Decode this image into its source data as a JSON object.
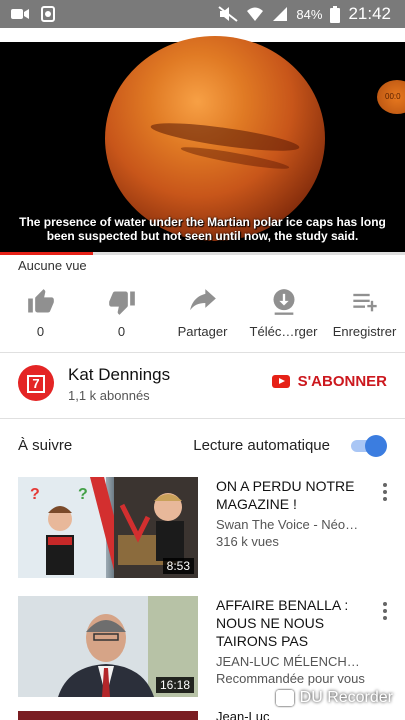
{
  "status_bar": {
    "battery": "84%",
    "time": "21:42",
    "left_icons": [
      "video-camera-icon",
      "recycle-notification-icon"
    ],
    "right_icons": [
      "mute-icon",
      "wifi-icon",
      "signal-icon",
      "battery-icon"
    ]
  },
  "player": {
    "subtitle": "The presence of water under the Martian polar ice caps has long been suspected but not seen until now, the study said.",
    "progress_fraction": 0.23,
    "overlay_badge": "00:0"
  },
  "video_info": {
    "views": "Aucune vue"
  },
  "actions": [
    {
      "icon": "thumbs-up-icon",
      "label": "0"
    },
    {
      "icon": "thumbs-down-icon",
      "label": "0"
    },
    {
      "icon": "share-icon",
      "label": "Partager"
    },
    {
      "icon": "download-icon",
      "label": "Téléc…rger"
    },
    {
      "icon": "add-to-playlist-icon",
      "label": "Enregistrer"
    }
  ],
  "channel": {
    "avatar_text": "7",
    "name": "Kat Dennings",
    "subscribers": "1,1 k abonnés",
    "subscribe_label": "S'ABONNER"
  },
  "up_next": {
    "label": "À suivre",
    "autoplay_label": "Lecture automatique",
    "autoplay_on": true
  },
  "videos": [
    {
      "title": "ON A PERDU NOTRE MAGAZINE !",
      "channel": "Swan The Voice - Néo…",
      "meta": "316 k vues",
      "duration": "8:53"
    },
    {
      "title": "AFFAIRE BENALLA : NOUS NE NOUS TAIRONS PAS",
      "channel": "JEAN-LUC MÉLENCH…",
      "meta": "Recommandée pour vous",
      "duration": "16:18"
    },
    {
      "title": "Jean-Luc"
    }
  ],
  "watermark": "DU Recorder",
  "colors": {
    "accent_red": "#e62117",
    "toggle_blue": "#3b7de0",
    "status_bar": "#7a7a7a"
  }
}
